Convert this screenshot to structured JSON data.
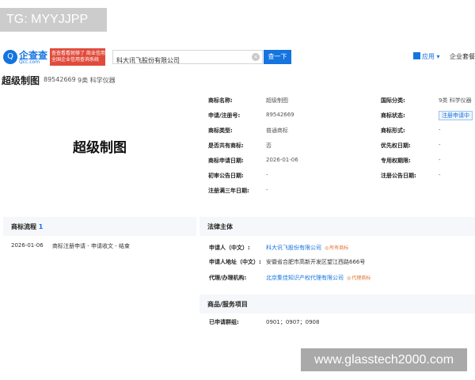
{
  "overlay_tag": "TG: MYYJJPP",
  "header": {
    "logo_text": "企查查",
    "logo_sub": "Qcc.com",
    "slogan_line1": "查查看看就够了 商业信用查询",
    "slogan_line2": "全国企业信用查询系统",
    "search_value": "科大讯飞股份有限公司",
    "search_button": "查一下",
    "apps_label": "应用",
    "enterprise_label": "企业套餐"
  },
  "title_bar": {
    "title": "超级制图",
    "reg_no": "89542669",
    "class_text": "9类 科学仪器"
  },
  "trademark": {
    "preview_text": "超级制图",
    "fields_left": [
      {
        "label": "商标名称:",
        "value": "超级制图"
      },
      {
        "label": "申请/注册号:",
        "value": "89542669"
      },
      {
        "label": "商标类型:",
        "value": "普通商标"
      },
      {
        "label": "是否共有商标:",
        "value": "否"
      },
      {
        "label": "商标申请日期:",
        "value": "2026-01-06"
      },
      {
        "label": "初审公告日期:",
        "value": "-"
      },
      {
        "label": "注册满三年日期:",
        "value": "-"
      }
    ],
    "fields_right": [
      {
        "label": "国际分类:",
        "value": "9类 科学仪器"
      },
      {
        "label": "商标状态:",
        "value": "注册申请中"
      },
      {
        "label": "商标形式:",
        "value": "-"
      },
      {
        "label": "优先权日期:",
        "value": "-"
      },
      {
        "label": "专用权期限:",
        "value": "-"
      },
      {
        "label": "注册公告日期:",
        "value": "-"
      }
    ]
  },
  "flow": {
    "heading": "商标流程",
    "count": "1",
    "items": [
      {
        "date": "2026-01-06",
        "desc": "商标注册申请 - 申请收文 - 结束"
      }
    ]
  },
  "legal": {
    "heading": "法律主体",
    "applicant_label": "申请人（中文）:",
    "applicant_value": "科大讯飞股份有限公司",
    "applicant_tag": "所有商标",
    "address_label": "申请人地址（中文）:",
    "address_value": "安徽省合肥市高新开发区望江西路666号",
    "agent_label": "代理/办理机构:",
    "agent_value": "北京集佳知识产权代理有限公司",
    "agent_tag": "代理商标"
  },
  "goods": {
    "heading": "商品/服务项目",
    "groups_label": "已申请群组:",
    "groups_value": "0901；0907；0908"
  },
  "watermark": "www.glasstech2000.com"
}
